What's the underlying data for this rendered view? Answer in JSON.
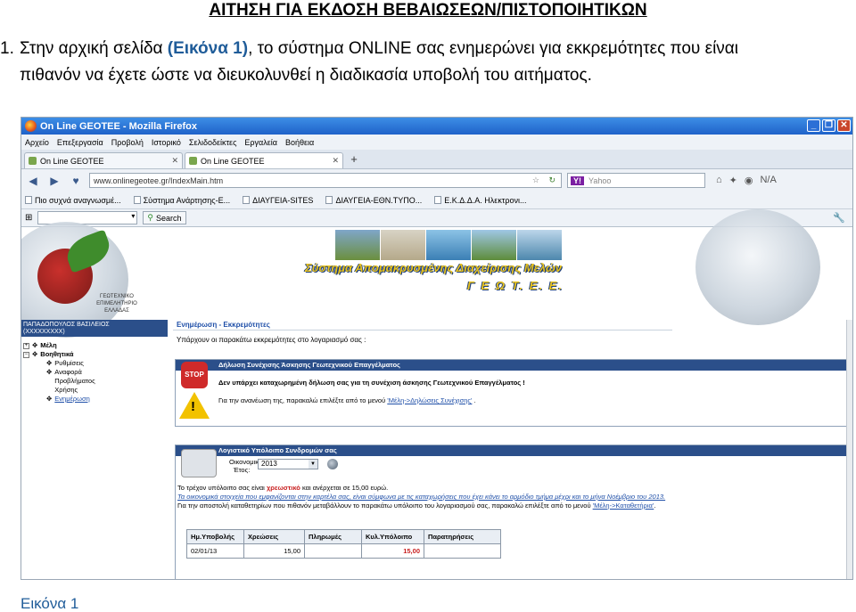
{
  "doc": {
    "title": "ΑΙΤΗΣΗ ΓΙΑ ΕΚΔΟΣΗ ΒΕΒΑΙΩΣΕΩΝ/ΠΙΣΤΟΠΟΙΗΤΙΚΩΝ",
    "item_number": "1.",
    "para_part1": "Στην αρχική σελίδα ",
    "para_link": "(Εικόνα 1)",
    "para_part2": ", το σύστημα ONLINE σας ενημερώνει για εκκρεμότητες που είναι",
    "para_line2": "πιθανόν να έχετε ώστε να διευκολυνθεί η διαδικασία υποβολή του αιτήματος.",
    "caption": "Εικόνα 1"
  },
  "browser": {
    "window_title": "On Line GEOTEE - Mozilla Firefox",
    "menu": [
      "Αρχείο",
      "Επεξεργασία",
      "Προβολή",
      "Ιστορικό",
      "Σελιδοδείκτες",
      "Εργαλεία",
      "Βοήθεια"
    ],
    "tabs": [
      "On Line GEOTEE",
      "On Line GEOTEE"
    ],
    "url": "www.onlinegeotee.gr/IndexMain.htm",
    "search_engine": "Y!",
    "search_placeholder": "Yahoo",
    "bookmarks": [
      "Πιο συχνά αναγνωσμέ...",
      "Σύστημα Ανάρτησης-Ε...",
      "ΔΙΑΥΓΕΙΑ-SITES",
      "ΔΙΑΥΓΕΙΑ-ΕΘΝ.ΤΥΠΟ...",
      "Ε.Κ.Δ.Δ.Α. Ηλεκτρονι..."
    ],
    "toolbar_search_label": "Search",
    "nav_right_extra": "N/A"
  },
  "site": {
    "logo_text": "ΓΕΩΤΕΧΝΙΚΟ ΕΠΙΜΕΛΗΤΗΡΙΟ ΕΛΛΑΔΑΣ",
    "banner_title": "Σύστημα Απομακρυσμένης Διαχείρισης Μελών",
    "banner_sub": "Γ Ε Ω Τ. Ε. Ε.",
    "user_name": "ΠΑΠΑΔΟΠΟΥΛΟΣ ΒΑΣΙΛΕΙΟΣ",
    "user_extra": "(ΧΧΧΧΧΧΧΧΧ)",
    "tree": {
      "members": "Μέλη",
      "help": "Βοηθητικά",
      "sub": [
        "Ρυθμίσεις",
        "Αναφορά Προβλήματος Χρήσης",
        "Ενημέρωση"
      ]
    },
    "breadcrumb": "Ενημέρωση   - Εκκρεμότητες",
    "intro": "Υπάρχουν οι παρακάτω εκκρεμότητες στο λογαριασμό σας :",
    "panel1": {
      "header": "Δήλωση Συνέχισης Άσκησης Γεωτεχνικού Επαγγέλματος",
      "stop_label": "STOP",
      "warn_mark": "!",
      "line1": "Δεν υπάρχει καταχωρημένη δήλωση σας για τη συνέχιση άσκησης Γεωτεχνικού Επαγγέλματος !",
      "line2_pre": "Για την ανανέωση της, παρακαλώ επιλέξτε από το μενού ",
      "line2_link": "'Μέλη->Δηλώσεις Συνέχισης'",
      "line2_post": " ."
    },
    "panel2": {
      "header": "Λογιστικό Υπόλοιπο Συνδρομών σας",
      "fiscal_label": "Οικονομικό Έτος:",
      "year": "2013",
      "line1_pre": "Το τρέχον υπόλοιπο σας είναι ",
      "line1_bold": "χρεωστικό",
      "line1_post": " και ανέρχεται σε 15,00 ευρώ.",
      "line2": "Τα οικονομικά στοιχεία που εμφανίζονται στην καρτέλα σας, είναι σύμφωνα με τις καταχωρήσεις που έχει κάνει το αρμόδιο τμήμα μέχρι και το μήνα Νοέμβριο του 2013.",
      "line3_pre": "Για την αποστολή καταθετηρίων που πιθανόν μεταβάλλουν το παρακάτω υπόλοιπο του λογαριασμού σας, παρακαλώ επιλέξτε από το μενού ",
      "line3_link": "'Μέλη->Καταθετήρια'",
      "line3_post": ".",
      "table": {
        "headers": [
          "Ημ.Υποβολής",
          "Χρεώσεις",
          "Πληρωμές",
          "Κυλ.Υπόλοιπο",
          "Παρατηρήσεις"
        ],
        "rows": [
          [
            "02/01/13",
            "15,00",
            "",
            "15,00",
            ""
          ]
        ]
      }
    }
  },
  "colors": {
    "accent_blue": "#2b4f8a",
    "link_blue": "#1f5c99",
    "warning_red": "#c81e1e",
    "banner_yellow": "#e8c21e"
  }
}
